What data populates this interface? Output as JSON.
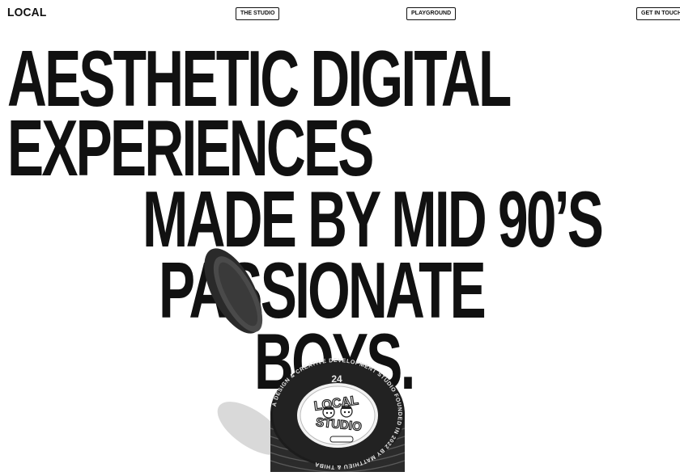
{
  "header": {
    "logo": "LOCAL",
    "nav": {
      "studio": "THE STUDIO",
      "playground": "PLAYGROUND",
      "contact": "GET IN TOUCH"
    }
  },
  "hero": {
    "lines": [
      "AESTHETIC DIGITAL",
      "EXPERIENCES",
      "MADE BY MID 90’S",
      "PASSIONATE",
      "BOYS."
    ]
  },
  "tin": {
    "year": "24",
    "badge_top": "LOCAL",
    "badge_bottom": "STUDIO",
    "ring_text": "A DESIGN & CREATIVE DEVELOPMENT STUDIO FOUNDED IN 2022 BY MATTHIEU & THIBA"
  }
}
